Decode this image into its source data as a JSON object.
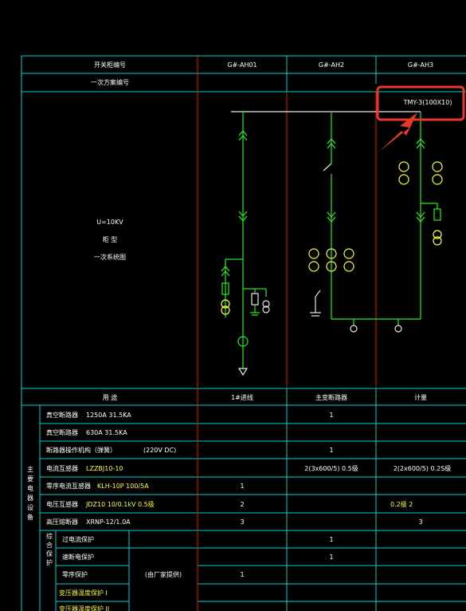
{
  "header": {
    "row1_label": "开关柜编号",
    "row2_label": "一次方案编号",
    "cols": [
      "G#-AH01",
      "G#-AH2",
      "G#-AH3"
    ],
    "busbar": "TMY-3(100X10)"
  },
  "left_info": [
    "U=10KV",
    "柜 型",
    "一次系统图"
  ],
  "usage": {
    "label": "用    途",
    "values": [
      "1#进线",
      "主变断路器",
      "计量"
    ]
  },
  "equipment_side": "主要电器设备",
  "rows": [
    {
      "name": "真空断路器",
      "spec": "1250A  31.5KA",
      "c1": "",
      "c2": "1",
      "c3": "",
      "hl": false
    },
    {
      "name": "真空断路器",
      "spec": "630A  31.5KA",
      "c1": "",
      "c2": "",
      "c3": "",
      "hl": false
    },
    {
      "name": "断路器操作机构（弹簧）",
      "spec": "(220V DC)",
      "c1": "",
      "c2": "1",
      "c3": "",
      "hl": false
    },
    {
      "name": "电流互感器",
      "spec": "LZZBJ10-10",
      "c1": "",
      "c2": "2(3x600/5)  0.5级",
      "c3": "2(2x600/5)  0.2S级",
      "hl": true
    },
    {
      "name": "零序电流互感器",
      "spec": "KLH-10P 100/5A",
      "c1": "1",
      "c2": "",
      "c3": "",
      "hl": true
    },
    {
      "name": "电压互感器",
      "spec": "JDZ10  10/0.1kV  0.5级",
      "c1": "2",
      "c2": "",
      "c3": "0.2级    2",
      "hl": true
    },
    {
      "name": "高压熔断器",
      "spec": "XRNP-12/1.0A",
      "c1": "3",
      "c2": "",
      "c3": "3",
      "hl": false
    }
  ],
  "protection_group": "综合保护",
  "protection_rows": [
    {
      "name": "过电流保护",
      "c2": "1"
    },
    {
      "name": "速断电保护",
      "c2": "1"
    },
    {
      "name": "零序保护",
      "c1": "1"
    },
    {
      "name": "变压器温度保护 I",
      "c1": ""
    },
    {
      "name": "变压器温度保护 II",
      "c1": ""
    }
  ],
  "protection_note": "(由厂家提供)"
}
